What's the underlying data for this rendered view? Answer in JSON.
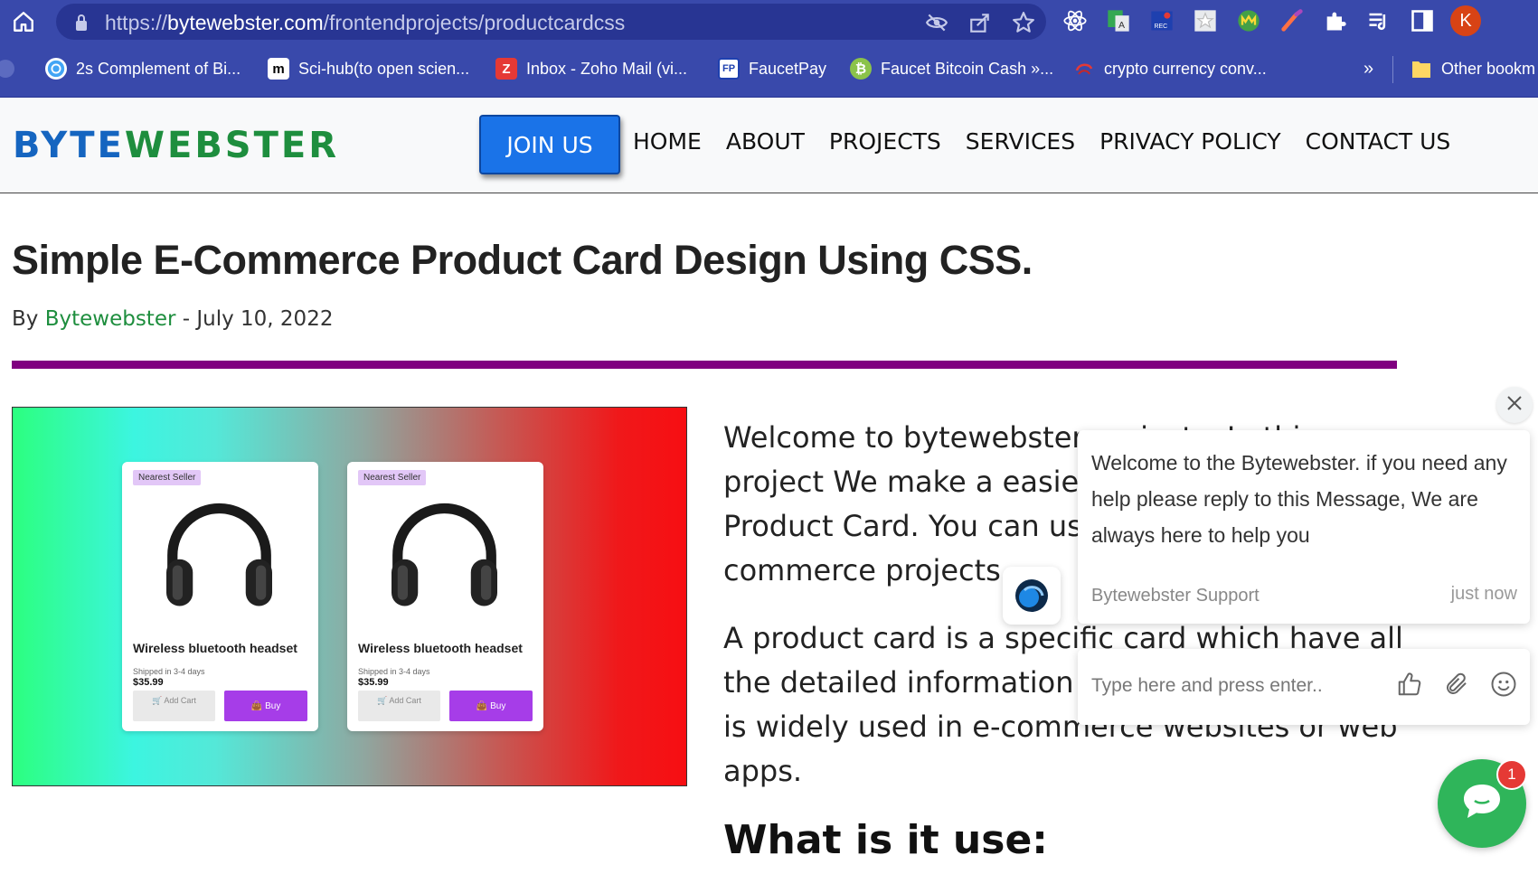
{
  "browser": {
    "url_prefix": "https://",
    "url_host": "bytewebster.com",
    "url_path": "/frontendprojects/productcardcss",
    "profile_initial": "K"
  },
  "bookmarks": [
    {
      "label": "2s Complement of Bi...",
      "icon": "globe-icon"
    },
    {
      "label": "Sci-hub(to open scien...",
      "icon": "m-logo-icon"
    },
    {
      "label": "Inbox - Zoho Mail (vi...",
      "icon": "z-logo-icon"
    },
    {
      "label": "FaucetPay",
      "icon": "fp-logo-icon"
    },
    {
      "label": "Faucet Bitcoin Cash »...",
      "icon": "bitcoin-icon"
    },
    {
      "label": "crypto currency conv...",
      "icon": "crypto-icon"
    },
    {
      "label": "Other bookm",
      "icon": "folder-icon"
    }
  ],
  "bookmarks_overflow": "»",
  "site": {
    "brand_part1": "BYTE",
    "brand_part2": "WEBSTER",
    "join_label": "JOIN US",
    "nav": [
      "HOME",
      "ABOUT",
      "PROJECTS",
      "SERVICES",
      "PRIVACY POLICY",
      "CONTACT US"
    ]
  },
  "article": {
    "title": "Simple E-Commerce Product Card Design Using CSS.",
    "by": "By",
    "author": "Bytewebster",
    "date_sep": " - ",
    "date": "July 10, 2022",
    "para1": "Welcome to bytewebster projects. In this project We make a easiest CSS E-Commerce Product Card. You can use this card for your e-commerce projects.",
    "para2": "A product card is a specific card which have all the detailed information about the product. it is widely used in e-commerce websites or web apps.",
    "subheading": "What is it use:"
  },
  "hero": {
    "cards": [
      {
        "tag": "Nearest Seller",
        "name": "Wireless bluetooth headset",
        "shipping": "Shipped in 3-4 days",
        "price": "$35.99",
        "add": "Add Cart",
        "buy": "Buy"
      },
      {
        "tag": "Nearest Seller",
        "name": "Wireless bluetooth headset",
        "shipping": "Shipped in 3-4 days",
        "price": "$35.99",
        "add": "Add Cart",
        "buy": "Buy"
      }
    ]
  },
  "chat": {
    "message": "Welcome to the Bytewebster. if you need any help please reply to this Message, We are always here to help you",
    "sender": "Bytewebster Support",
    "time": "just now",
    "input_placeholder": "Type here and press enter..",
    "badge": "1"
  },
  "colors": {
    "chrome": "#3949ab",
    "brand_blue": "#1565c0",
    "brand_green": "#1e8e3e",
    "divider": "#800080",
    "join_button": "#1a73e8",
    "buy_button": "#a63de8",
    "chat_launcher": "#2fb55a"
  }
}
